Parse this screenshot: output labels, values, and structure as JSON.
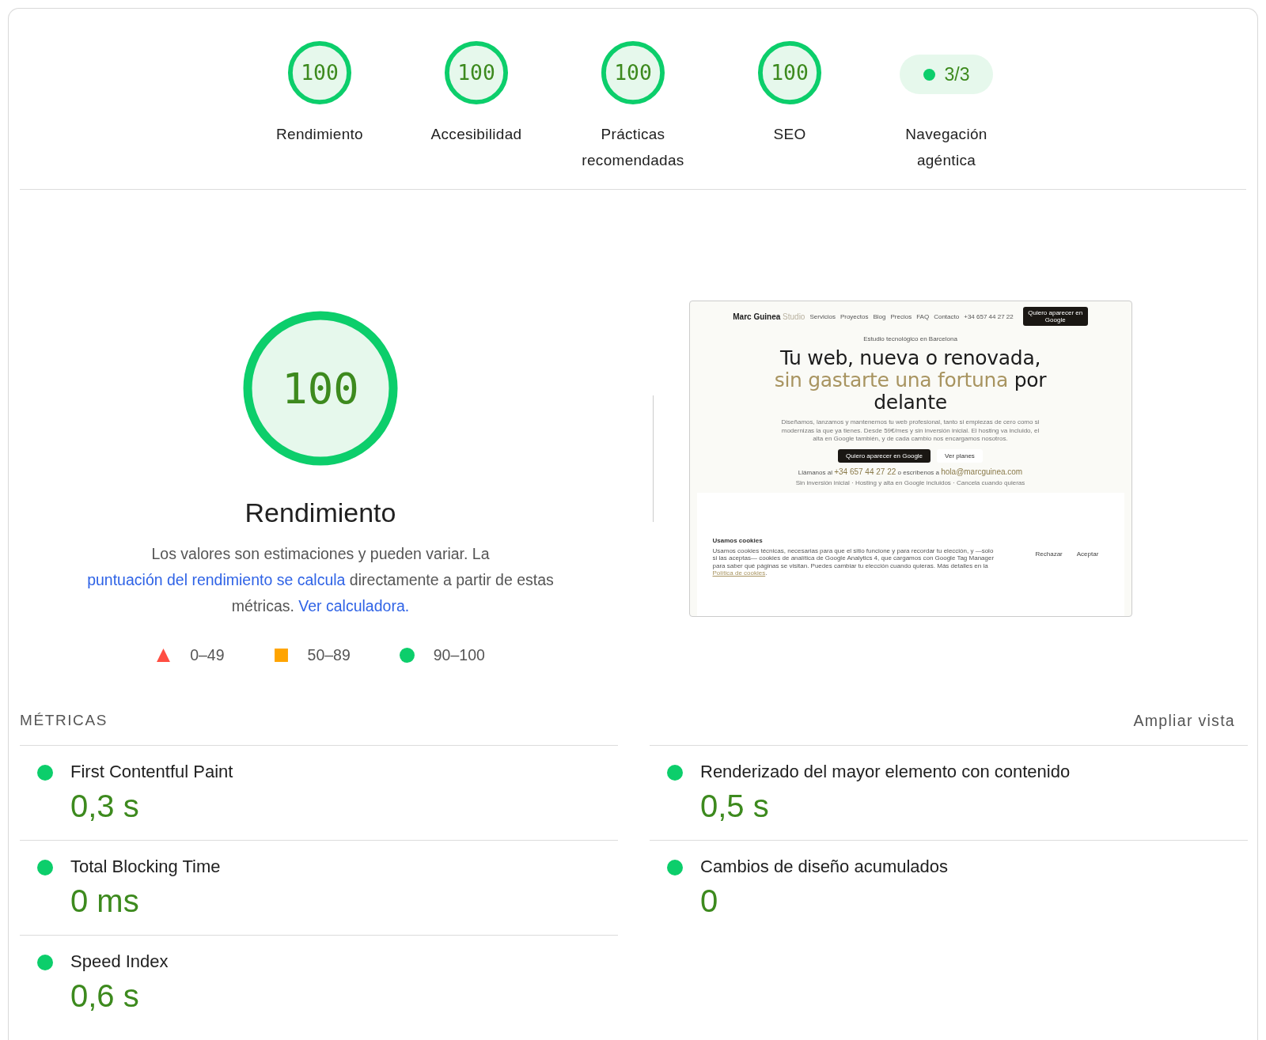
{
  "categories": [
    {
      "kind": "gauge",
      "score": "100",
      "label": "Rendimiento",
      "level": 1
    },
    {
      "kind": "gauge",
      "score": "100",
      "label": "Accesibilidad",
      "level": 1
    },
    {
      "kind": "gauge",
      "score": "100",
      "label": "Prácticas recomendadas",
      "level": 1
    },
    {
      "kind": "gauge",
      "score": "100",
      "label": "SEO",
      "level": 1
    },
    {
      "kind": "fraction",
      "score": "3/3",
      "label": "Navegación agéntica"
    }
  ],
  "performance": {
    "score": "100",
    "level": 1,
    "title": "Rendimiento",
    "description": "Los valores son estimaciones y pueden variar. La ",
    "link_1": "puntuación del rendimiento se calcula",
    "description_2": " directamente a partir de estas métricas. ",
    "link_2": "Ver calculadora."
  },
  "legend": [
    {
      "kind": "fail",
      "range": "0–49"
    },
    {
      "kind": "average",
      "range": "50–89"
    },
    {
      "kind": "pass",
      "range": "90–100"
    }
  ],
  "screenshot": {
    "logo": "Marc Guinea",
    "logo_suffix": "Studio",
    "nav": [
      "Servicios",
      "Proyectos",
      "Blog",
      "Precios",
      "FAQ",
      "Contacto"
    ],
    "phone": "+34 657 44 27 22",
    "nav_button": "Quiero aparecer en Google",
    "eyebrow": "Estudio tecnológico en Barcelona",
    "headline": [
      {
        "text": "Tu web, nueva o renovada, ",
        "accent": false
      },
      {
        "text": "sin gastarte una fortuna",
        "accent": true
      },
      {
        "text": " por delante",
        "accent": false
      }
    ],
    "body": "Diseñamos, lanzamos y mantenemos tu web profesional, tanto si empiezas de cero como si modernizas la que ya tienes. Desde 59€/mes y sin inversión inicial. El hosting va incluido, el alta en Google también, y de cada cambio nos encargamos nosotros.",
    "primary_button": "Quiero aparecer en Google",
    "secondary_button": "Ver planes",
    "contact_prefix": "Llámanos al",
    "contact_phone": "+34 657 44 27 22",
    "contact_mid": "o escríbenos a",
    "contact_email": "hola@marcguinea.com",
    "note": "Sin inversión inicial · Hosting y alta en Google incluidos · Cancela cuando quieras",
    "cookie_title": "Usamos cookies",
    "cookie_text": "Usamos cookies técnicas, necesarias para que el sitio funcione y para recordar tu elección, y —solo si las aceptas— cookies de analítica de Google Analytics 4, que cargamos con Google Tag Manager para saber qué páginas se visitan. Puedes cambiar tu elección cuando quieras. Más detalles en la ",
    "cookie_link": "Política de cookies",
    "cookie_end": ".",
    "reject": "Rechazar",
    "accept": "Aceptar"
  },
  "metrics": {
    "heading": "MÉTRICAS",
    "toggle": "Ampliar vista",
    "items": [
      {
        "name": "First Contentful Paint",
        "value": "0,3 s"
      },
      {
        "name": "Renderizado del mayor elemento con contenido",
        "value": "0,5 s"
      },
      {
        "name": "Total Blocking Time",
        "value": "0 ms"
      },
      {
        "name": "Cambios de diseño acumulados",
        "value": "0"
      },
      {
        "name": "Speed Index",
        "value": "0,6 s"
      }
    ]
  }
}
